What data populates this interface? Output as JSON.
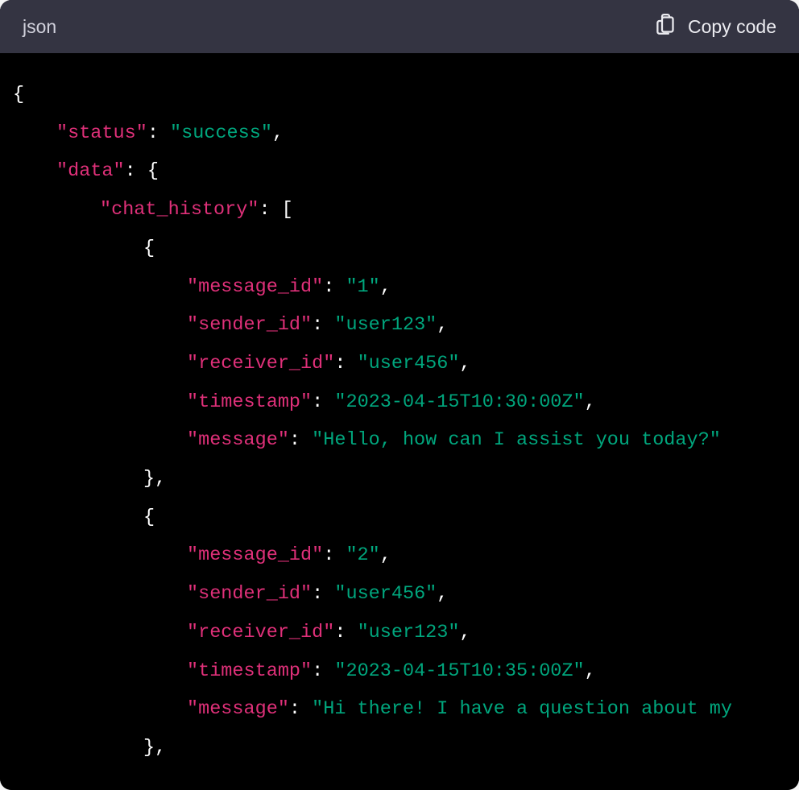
{
  "header": {
    "language_label": "json",
    "copy_label": "Copy code"
  },
  "code": {
    "root_status_key": "\"status\"",
    "root_status_val": "\"success\"",
    "root_data_key": "\"data\"",
    "chat_history_key": "\"chat_history\"",
    "msg1": {
      "message_id_key": "\"message_id\"",
      "message_id_val": "\"1\"",
      "sender_id_key": "\"sender_id\"",
      "sender_id_val": "\"user123\"",
      "receiver_id_key": "\"receiver_id\"",
      "receiver_id_val": "\"user456\"",
      "timestamp_key": "\"timestamp\"",
      "timestamp_val": "\"2023-04-15T10:30:00Z\"",
      "message_key": "\"message\"",
      "message_val": "\"Hello, how can I assist you today?\""
    },
    "msg2": {
      "message_id_key": "\"message_id\"",
      "message_id_val": "\"2\"",
      "sender_id_key": "\"sender_id\"",
      "sender_id_val": "\"user456\"",
      "receiver_id_key": "\"receiver_id\"",
      "receiver_id_val": "\"user123\"",
      "timestamp_key": "\"timestamp\"",
      "timestamp_val": "\"2023-04-15T10:35:00Z\"",
      "message_key": "\"message\"",
      "message_val": "\"Hi there! I have a question about my "
    }
  }
}
